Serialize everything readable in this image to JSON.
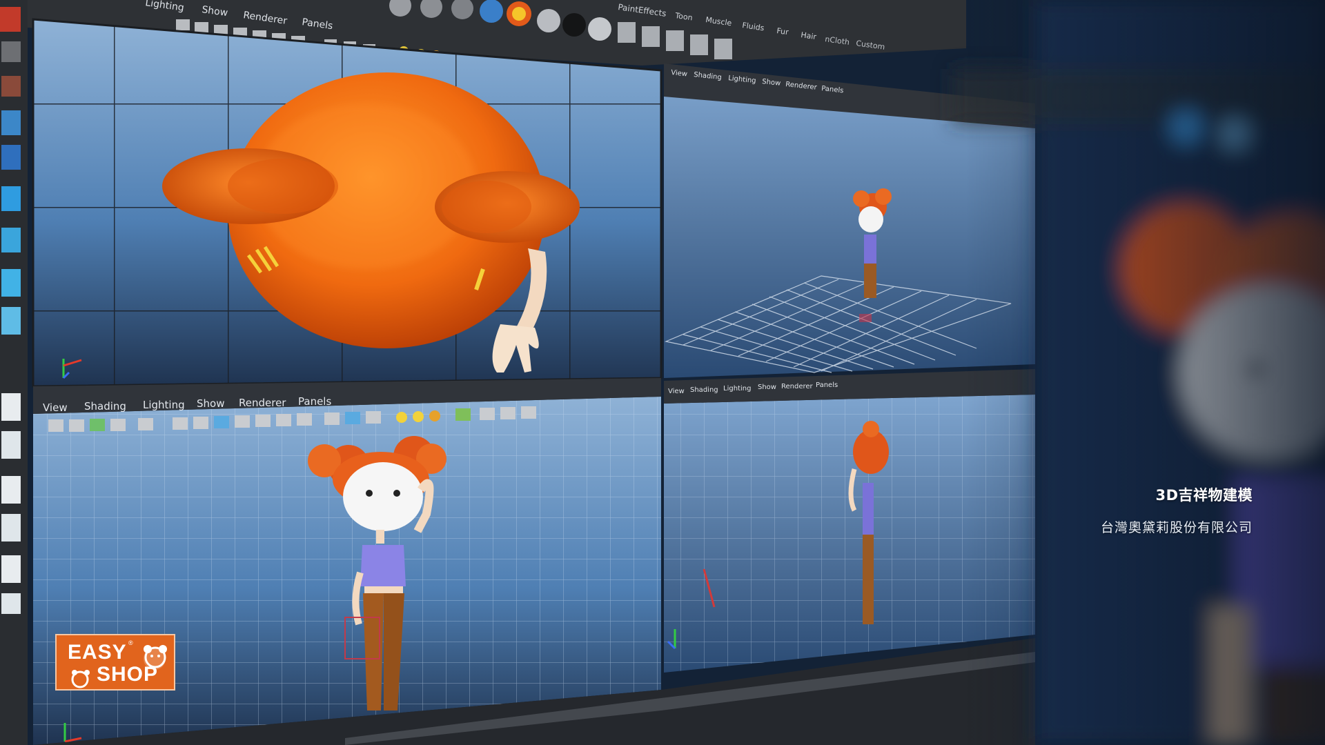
{
  "viewport_top": {
    "menu": [
      "Lighting",
      "Show",
      "Renderer",
      "Panels"
    ],
    "right_menu": [
      "PaintEffects",
      "Toon",
      "Muscle",
      "Fluids",
      "Fur",
      "Hair",
      "nCloth",
      "Custom"
    ]
  },
  "viewport_bottom_left": {
    "menu": [
      "View",
      "Shading",
      "Lighting",
      "Show",
      "Renderer",
      "Panels"
    ]
  },
  "viewport_small": {
    "menu": [
      "View",
      "Shading",
      "Lighting",
      "Show",
      "Renderer",
      "Panels"
    ]
  },
  "caption": {
    "title": "3D吉祥物建模",
    "company": "台灣奧黛莉股份有限公司"
  },
  "logo": {
    "line1": "EASY",
    "line2": "SHOP",
    "registered": "®"
  },
  "colors": {
    "accent_orange": "#e1641d",
    "viewport_blue": "#5d8fc4",
    "ui_dark": "#2c2f33"
  }
}
